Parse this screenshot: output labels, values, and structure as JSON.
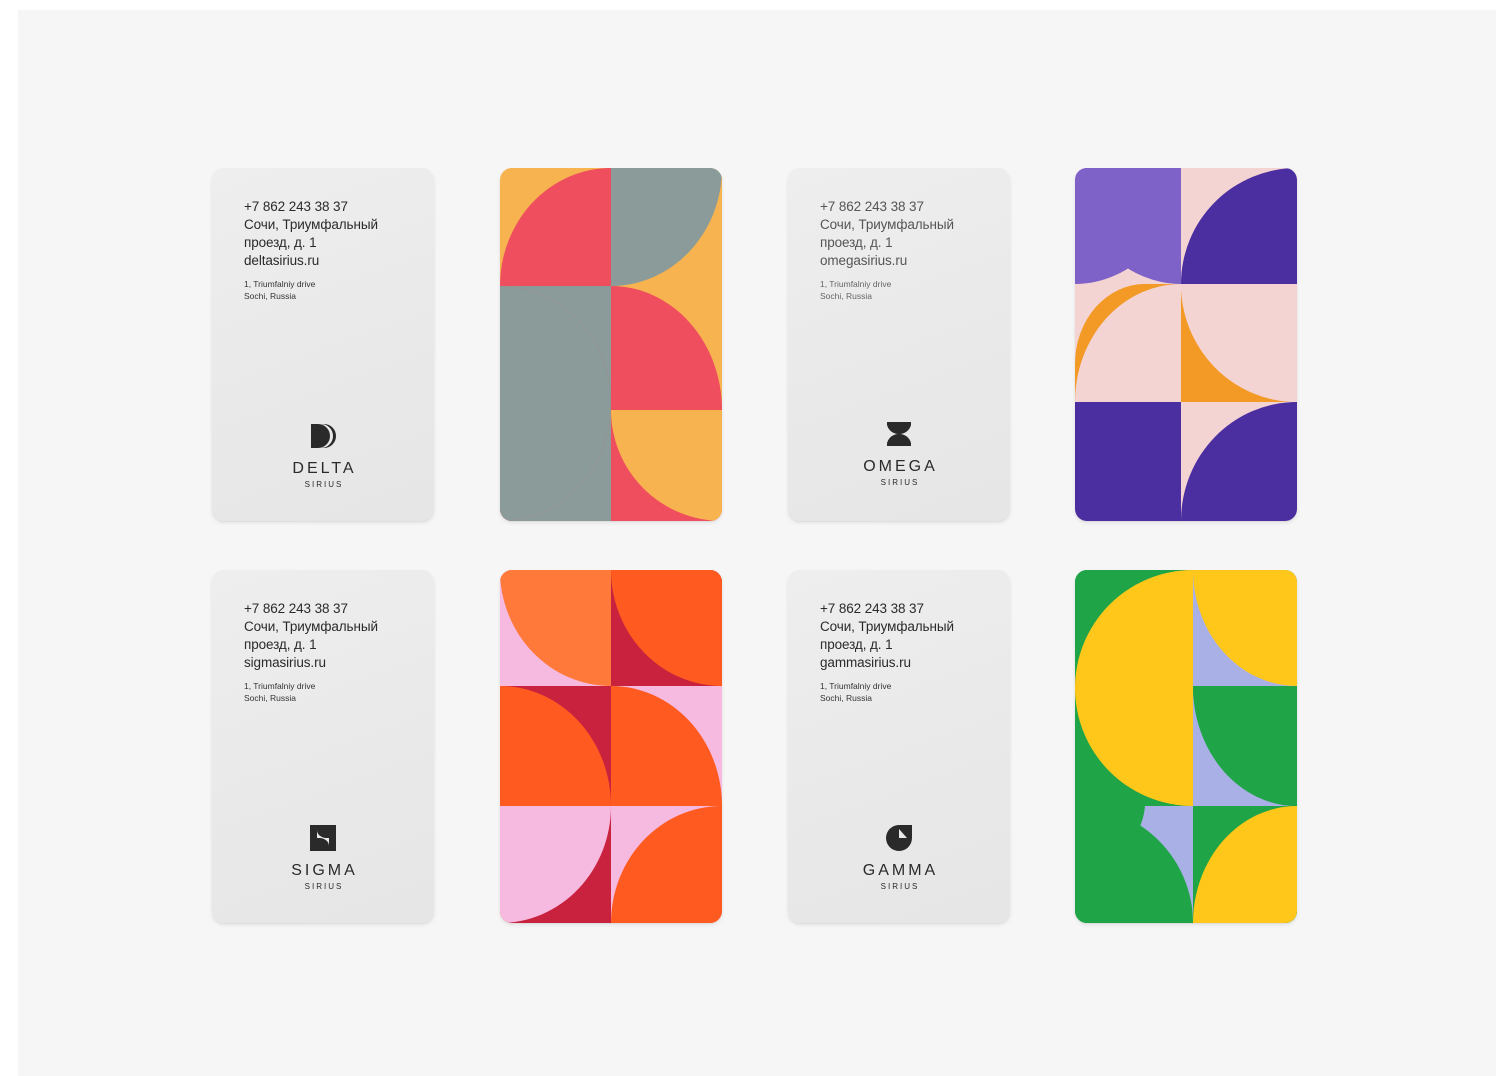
{
  "cards": {
    "delta": {
      "phone": "+7 862 243 38 37",
      "address_line1": "Сочи, Триумфальный",
      "address_line2": "проезд, д. 1",
      "website": "deltasirius.ru",
      "en_line1": "1, Triumfalniy drive",
      "en_line2": "Sochi, Russia",
      "brand": "DELTA",
      "sub": "SIRIUS",
      "logo_icon": "delta-d-icon"
    },
    "omega": {
      "phone": "+7 862 243 38 37",
      "address_line1": "Сочи, Триумфальный",
      "address_line2": "проезд, д. 1",
      "website": "omegasirius.ru",
      "en_line1": "1, Triumfalniy drive",
      "en_line2": "Sochi, Russia",
      "brand": "OMEGA",
      "sub": "SIRIUS",
      "logo_icon": "omega-hourglass-icon"
    },
    "sigma": {
      "phone": "+7 862 243 38 37",
      "address_line1": "Сочи, Триумфальный",
      "address_line2": "проезд, д. 1",
      "website": "sigmasirius.ru",
      "en_line1": "1, Triumfalniy drive",
      "en_line2": "Sochi, Russia",
      "brand": "SIGMA",
      "sub": "SIRIUS",
      "logo_icon": "sigma-s-icon"
    },
    "gamma": {
      "phone": "+7 862 243 38 37",
      "address_line1": "Сочи, Триумфальный",
      "address_line2": "проезд, д. 1",
      "website": "gammasirius.ru",
      "en_line1": "1, Triumfalniy drive",
      "en_line2": "Sochi, Russia",
      "brand": "GAMMA",
      "sub": "SIRIUS",
      "logo_icon": "gamma-g-icon"
    }
  },
  "patterns": {
    "delta": {
      "colors": [
        "#f7b34f",
        "#ef4e5f",
        "#8a9b99"
      ]
    },
    "omega": {
      "colors": [
        "#4b2fa0",
        "#f4d3d3",
        "#f29a25",
        "#7f62c8"
      ]
    },
    "sigma": {
      "colors": [
        "#ff5a1f",
        "#c8223e",
        "#f6b9df",
        "#ff7a3a"
      ]
    },
    "gamma": {
      "colors": [
        "#1fa447",
        "#ffc719",
        "#a9b0e6"
      ]
    }
  },
  "background_color": "#f6f6f6"
}
